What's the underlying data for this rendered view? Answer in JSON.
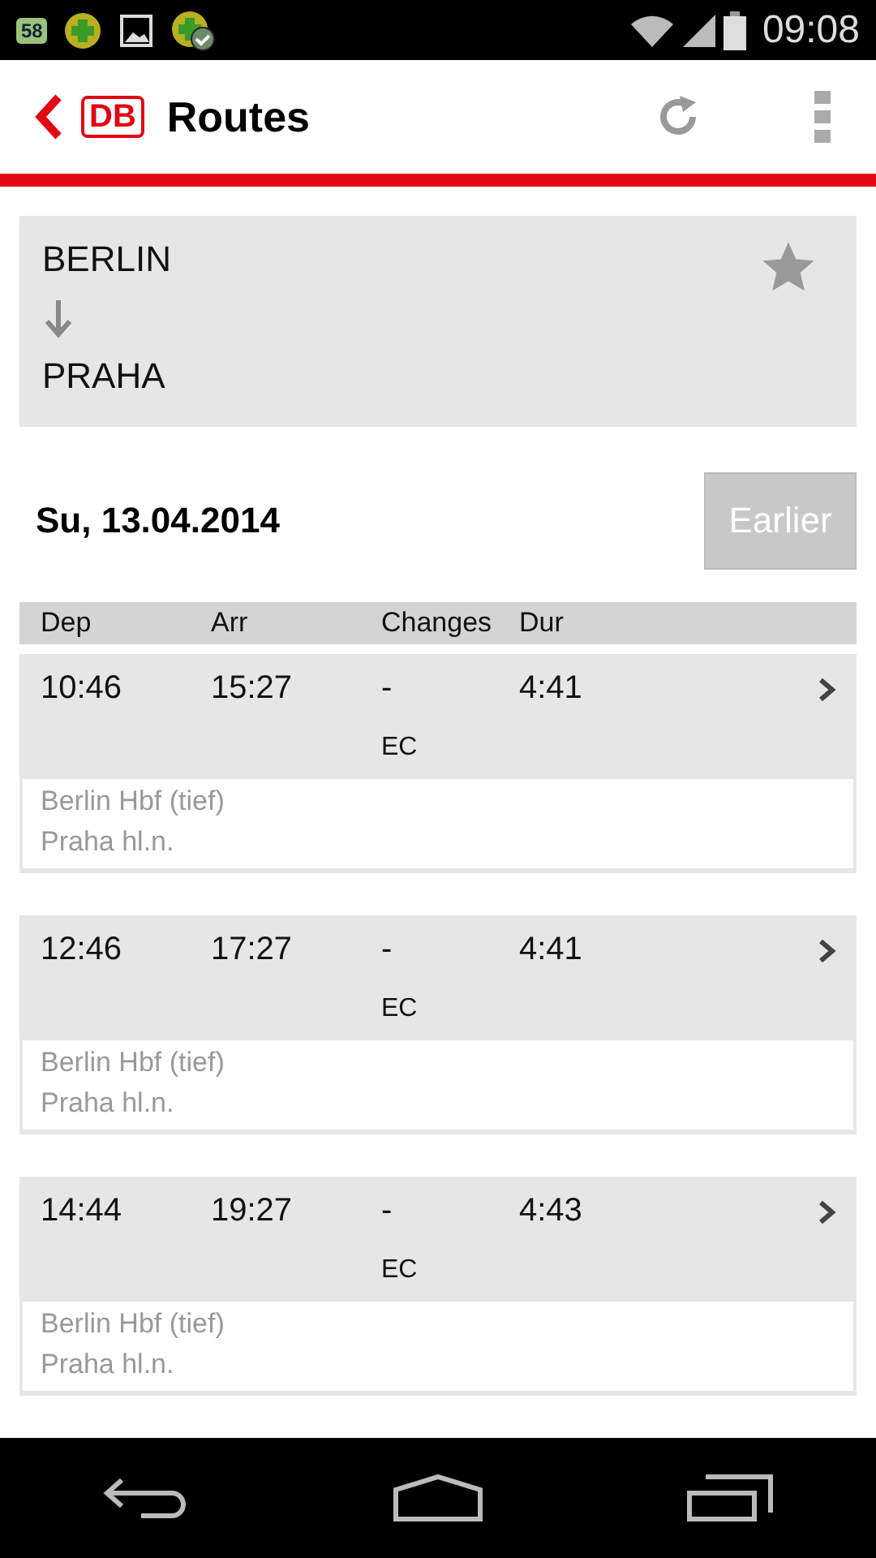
{
  "status_bar": {
    "battery_app_label": "58",
    "time": "09:08"
  },
  "app_bar": {
    "title": "Routes",
    "logo": "DB"
  },
  "route": {
    "from": "BERLIN",
    "to": "PRAHA",
    "favorite": false
  },
  "date": "Su, 13.04.2014",
  "earlier_button": "Earlier",
  "table": {
    "columns": [
      "Dep",
      "Arr",
      "Changes",
      "Dur"
    ],
    "rows": [
      {
        "dep": "10:46",
        "arr": "15:27",
        "changes": "-",
        "dur": "4:41",
        "product": "EC",
        "from_station": "Berlin Hbf (tief)",
        "to_station": "Praha hl.n."
      },
      {
        "dep": "12:46",
        "arr": "17:27",
        "changes": "-",
        "dur": "4:41",
        "product": "EC",
        "from_station": "Berlin Hbf (tief)",
        "to_station": "Praha hl.n."
      },
      {
        "dep": "14:44",
        "arr": "19:27",
        "changes": "-",
        "dur": "4:43",
        "product": "EC",
        "from_station": "Berlin Hbf (tief)",
        "to_station": "Praha hl.n."
      }
    ]
  }
}
